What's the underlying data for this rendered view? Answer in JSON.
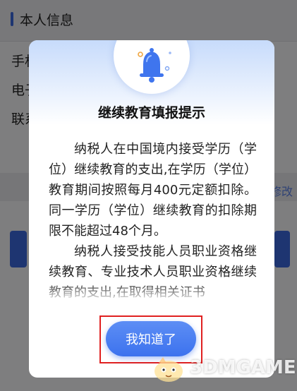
{
  "background": {
    "section_title": "本人信息",
    "rows": [
      "手机",
      "电子",
      "联系"
    ],
    "edit_link": "修改"
  },
  "dialog": {
    "icon": "bell-icon",
    "title": "继续教育填报提示",
    "paragraphs": [
      "纳税人在中国境内接受学历（学位）继续教育的支出,在学历（学位）教育期间按照每月400元定额扣除。同一学历（学位）继续教育的扣除期限不能超过48个月。",
      "纳税人接受技能人员职业资格继续教育、专业技术人员职业资格继续教育的支出,在取得相关证书"
    ],
    "ok_label": "我知道了"
  },
  "watermark": {
    "text": "3DMGAME"
  },
  "colors": {
    "accent": "#3c72ee",
    "highlight_frame": "#e02020",
    "overlay": "rgba(0,0,0,0.48)"
  }
}
